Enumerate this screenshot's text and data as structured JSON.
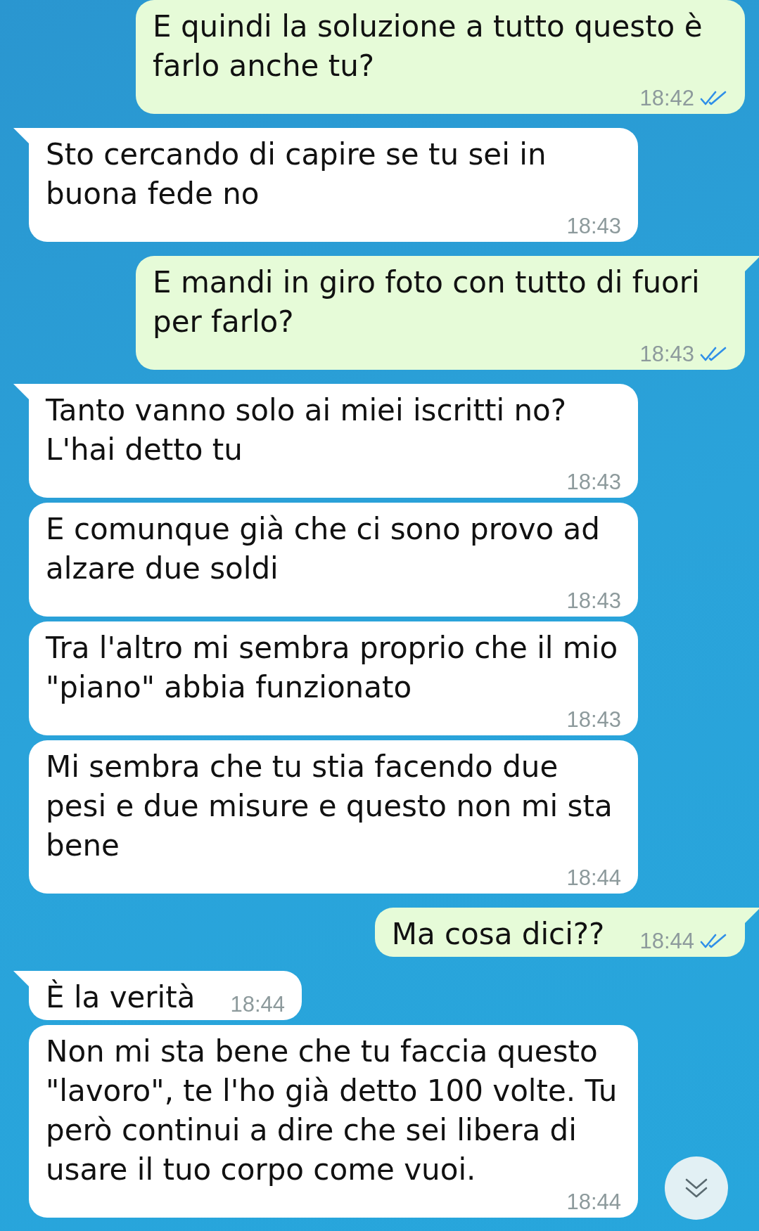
{
  "messages": [
    {
      "kind": "outgoing",
      "text": "E quindi la soluzione a tutto questo è farlo anche tu?",
      "time": "18:42",
      "read": true,
      "tail": false
    },
    {
      "kind": "incoming",
      "text": "Sto cercando di capire se tu sei in buona fede no",
      "time": "18:43",
      "tail": true
    },
    {
      "kind": "outgoing",
      "text": "E mandi in giro foto con tutto di fuori per farlo?",
      "time": "18:43",
      "read": true,
      "tail": true
    },
    {
      "kind": "incoming",
      "text": "Tanto vanno solo ai miei iscritti no? L'hai detto tu",
      "time": "18:43",
      "tail": true
    },
    {
      "kind": "incoming",
      "text": "E comunque già che ci sono provo ad alzare due soldi",
      "time": "18:43",
      "tail": false
    },
    {
      "kind": "incoming",
      "text": "Tra l'altro mi sembra proprio che il mio \"piano\" abbia funzionato",
      "time": "18:43",
      "tail": false
    },
    {
      "kind": "incoming",
      "text": "Mi sembra che tu stia facendo due pesi e due misure e questo non mi sta bene",
      "time": "18:44",
      "tail": false
    },
    {
      "kind": "outgoing",
      "text": "Ma cosa dici??",
      "time": "18:44",
      "read": true,
      "tail": true
    },
    {
      "kind": "incoming",
      "text": "È la verità",
      "time": "18:44",
      "tail": true
    },
    {
      "kind": "incoming",
      "text": "Non mi sta bene che tu faccia questo \"lavoro\", te l'ho già detto 100 volte. Tu però continui a dire che sei libera di usare il tuo corpo come vuoi.",
      "time": "18:44",
      "tail": false
    }
  ]
}
